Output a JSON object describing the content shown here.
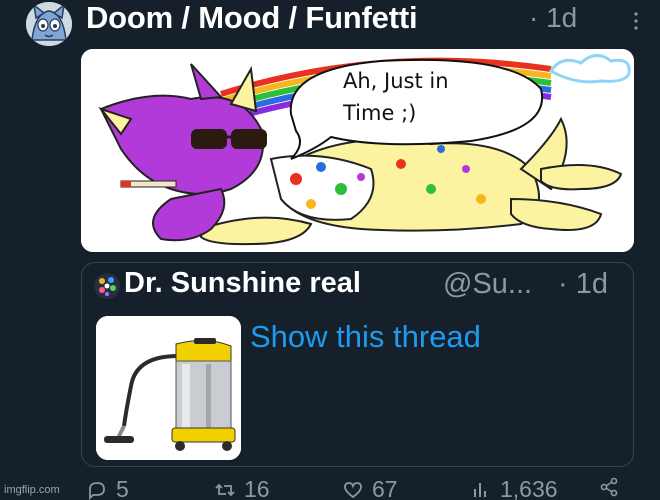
{
  "tweet": {
    "author_name": "Doom / Mood / Funfetti",
    "separator_time": "· 1d",
    "avatar_icon": "cat-avatar-icon",
    "more_icon": "more-vertical-icon"
  },
  "media": {
    "speech_line_1": "Ah, Just in",
    "speech_line_2": "Time ;)"
  },
  "quote": {
    "author_name": "Dr. Sunshine real",
    "handle": "@Su...",
    "separator_time": "· 1d",
    "thumbnail_icon": "vacuum-cleaner-image",
    "show_thread": "Show this thread"
  },
  "actions": {
    "replies": "5",
    "retweets": "16",
    "likes": "67",
    "views": "1,636"
  },
  "watermark": "imgflip.com",
  "colors": {
    "background": "#15202b",
    "link": "#1d9bf0",
    "muted": "#8b98a5",
    "border": "#38444d"
  }
}
